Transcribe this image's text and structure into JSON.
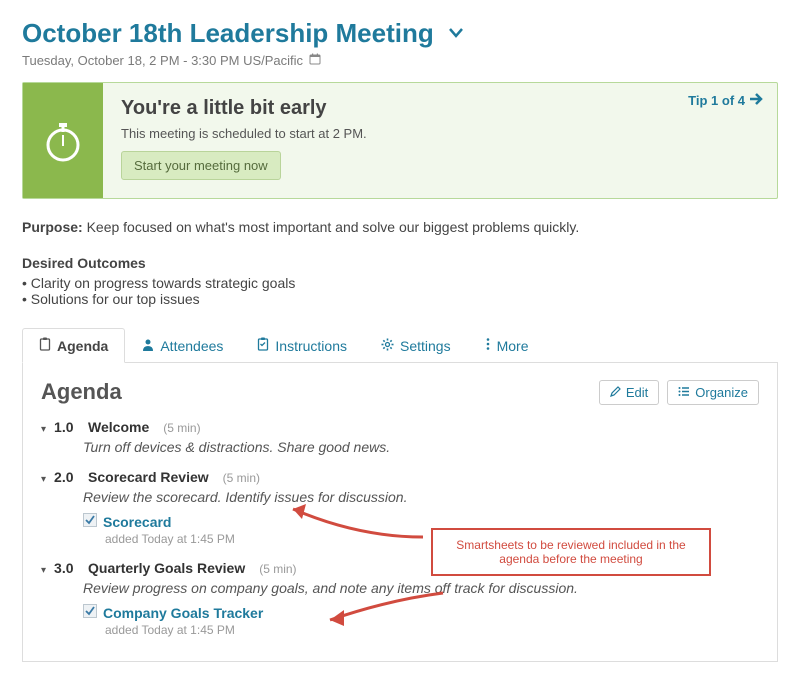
{
  "header": {
    "title": "October 18th Leadership Meeting",
    "subtitle": "Tuesday, October 18, 2 PM - 3:30 PM US/Pacific"
  },
  "banner": {
    "heading": "You're a little bit early",
    "message": "This meeting is scheduled to start at 2 PM.",
    "button": "Start your meeting now",
    "tip": "Tip 1 of 4"
  },
  "purpose": {
    "label": "Purpose:",
    "text": " Keep focused on what's most important and solve our biggest problems quickly."
  },
  "outcomes": {
    "label": "Desired Outcomes",
    "items": [
      "Clarity on progress towards strategic goals",
      "Solutions for our top issues"
    ]
  },
  "tabs": {
    "agenda": "Agenda",
    "attendees": "Attendees",
    "instructions": "Instructions",
    "settings": "Settings",
    "more": "More"
  },
  "panel": {
    "title": "Agenda",
    "edit": "Edit",
    "organize": "Organize"
  },
  "agenda": [
    {
      "num": "1.0",
      "title": "Welcome",
      "dur": "(5 min)",
      "desc": "Turn off devices & distractions.  Share good news."
    },
    {
      "num": "2.0",
      "title": "Scorecard Review",
      "dur": "(5 min)",
      "desc": "Review the scorecard. Identify issues for discussion.",
      "attach": {
        "name": "Scorecard",
        "meta": "added Today at 1:45 PM"
      }
    },
    {
      "num": "3.0",
      "title": "Quarterly Goals Review",
      "dur": "(5 min)",
      "desc": "Review progress on company goals, and note any items off track for discussion.",
      "attach": {
        "name": "Company Goals Tracker",
        "meta": "added Today at 1:45 PM"
      }
    }
  ],
  "annotation": "Smartsheets to be reviewed included in the agenda before the meeting"
}
